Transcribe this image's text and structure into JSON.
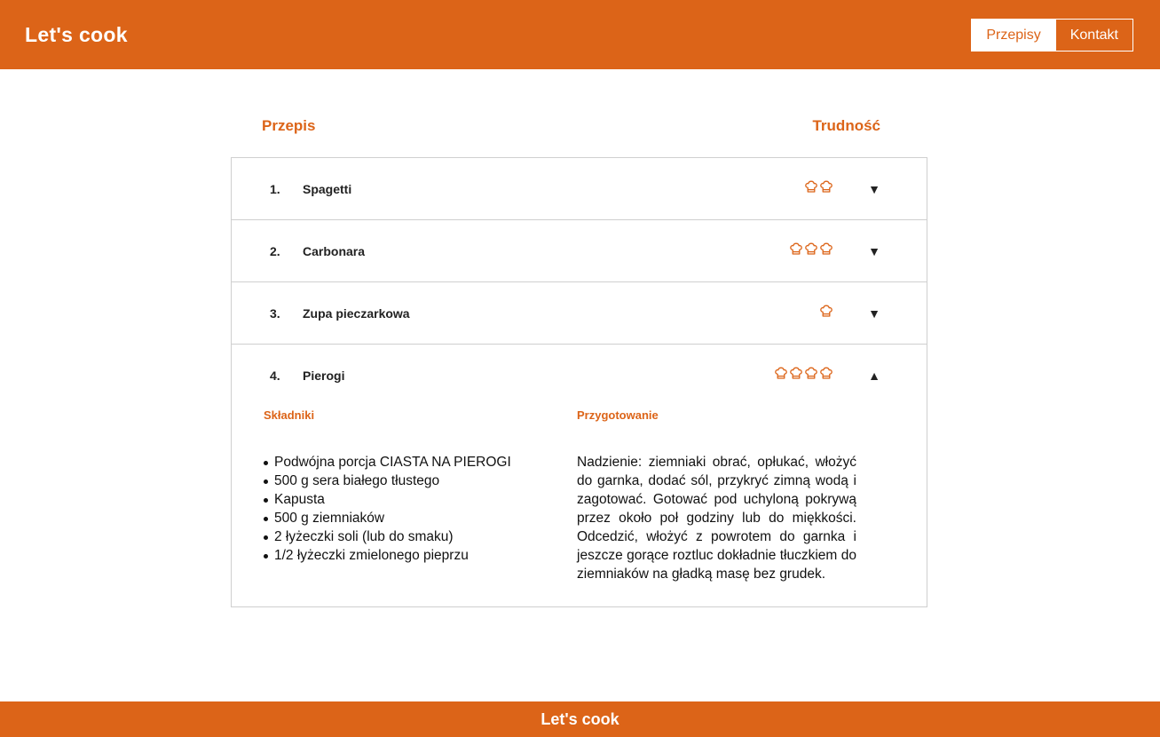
{
  "header": {
    "logo": "Let's cook",
    "nav": [
      "Przepisy",
      "Kontakt"
    ]
  },
  "table_head": {
    "recipe": "Przepis",
    "difficulty": "Trudność"
  },
  "recipes": [
    {
      "number": "1.",
      "name": "Spagetti",
      "difficulty": 2,
      "arrow": "▼"
    },
    {
      "number": "2.",
      "name": "Carbonara",
      "difficulty": 3,
      "arrow": "▼"
    },
    {
      "number": "3.",
      "name": "Zupa pieczarkowa",
      "difficulty": 1,
      "arrow": "▼"
    },
    {
      "number": "4.",
      "name": "Pierogi",
      "difficulty": 4,
      "arrow": "▲"
    }
  ],
  "open_recipe": {
    "ingredients_title": "Składniki",
    "preparation_title": "Przygotowanie",
    "ingredients": [
      "Podwójna porcja CIASTA NA PIEROGI",
      "500 g sera białego tłustego",
      "Kapusta",
      "500 g ziemniaków",
      "2 łyżeczki soli (lub do smaku)",
      "1/2 łyżeczki zmielonego pieprzu"
    ],
    "preparation": "Nadzienie: ziemniaki obrać, opłukać, włożyć do garnka, dodać sól, przykryć zimną wodą i zagotować. Gotować pod uchyloną pokrywą przez około poł godziny lub do miękkości. Odcedzić, włożyć z powrotem do garnka i jeszcze gorące roztluc dokładnie tłuczkiem do ziemniaków na gładką masę bez grudek."
  },
  "footer": {
    "text": "Let's cook"
  },
  "colors": {
    "accent": "#dc6418",
    "border": "#cfcfcf"
  },
  "icons": {
    "difficulty": "chef-hat-icon"
  }
}
